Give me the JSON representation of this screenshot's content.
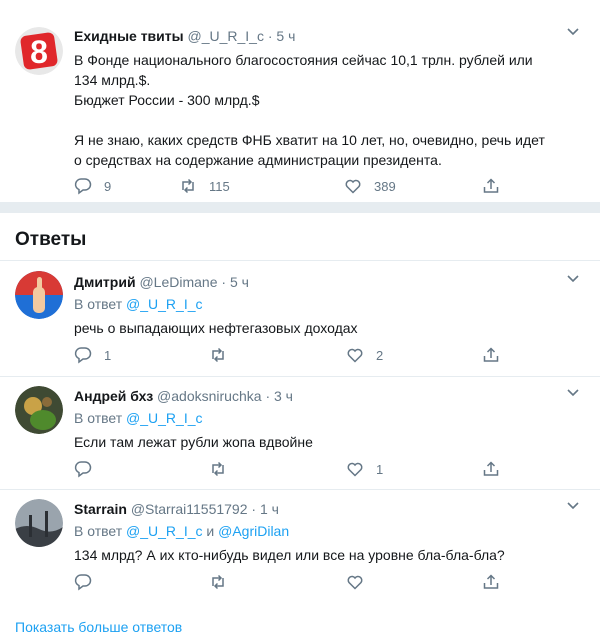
{
  "main_tweet": {
    "author_name": "Ехидные твиты",
    "handle": "@_U_R_I_c",
    "separator": "·",
    "time": "5 ч",
    "avatar_glyph": "8",
    "text_lines": [
      "В Фонде национального благосостояния сейчас 10,1 трлн. рублей или",
      "134 млрд.$.",
      "Бюджет России - 300 млрд.$",
      "",
      "Я не знаю, каких средств ФНБ хватит на 10 лет, но, очевидно, речь идет",
      "о средствах на содержание администрации президента."
    ],
    "replies": "9",
    "retweets": "115",
    "likes": "389"
  },
  "answers_heading": "Ответы",
  "replies": [
    {
      "author_name": "Дмитрий",
      "handle": "@LeDimane",
      "separator": "·",
      "time": "5 ч",
      "reply_prefix": "В ответ",
      "mention1": "@_U_R_I_c",
      "conj": "",
      "mention2": "",
      "text": "речь о выпадающих нефтегазовых доходах",
      "replies": "1",
      "retweets": "",
      "likes": "2"
    },
    {
      "author_name": "Андрей бхз",
      "handle": "@adoksniruchka",
      "separator": "·",
      "time": "3 ч",
      "reply_prefix": "В ответ",
      "mention1": "@_U_R_I_c",
      "conj": "",
      "mention2": "",
      "text": "Если там лежат рубли жопа вдвойне",
      "replies": "",
      "retweets": "",
      "likes": "1"
    },
    {
      "author_name": "Starrain",
      "handle": "@Starrai11551792",
      "separator": "·",
      "time": "1 ч",
      "reply_prefix": "В ответ",
      "mention1": "@_U_R_I_c",
      "conj": "и",
      "mention2": "@AgriDilan",
      "text": "134 млрд? А их кто-нибудь видел или все на уровне бла-бла-бла?",
      "replies": "",
      "retweets": "",
      "likes": ""
    }
  ],
  "show_more": "Показать больше ответов",
  "colors": {
    "accent": "#1da1f2",
    "muted": "#657786",
    "text": "#14171a",
    "divider": "#e6ecf0"
  }
}
